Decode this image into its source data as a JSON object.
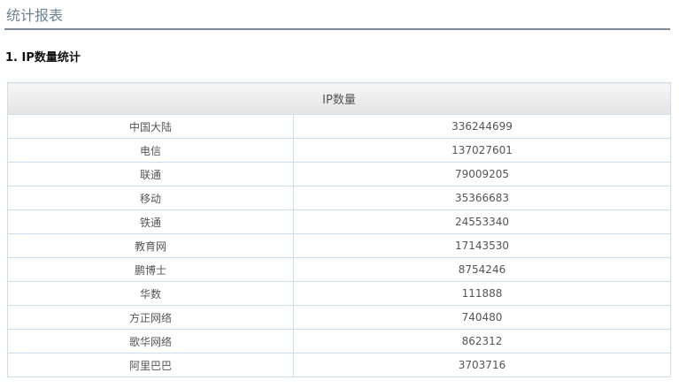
{
  "page_title": "统计报表",
  "section_title": "1. IP数量统计",
  "table": {
    "header": "IP数量",
    "rows": [
      {
        "name": "中国大陆",
        "count": "336244699"
      },
      {
        "name": "电信",
        "count": "137027601"
      },
      {
        "name": "联通",
        "count": "79009205"
      },
      {
        "name": "移动",
        "count": "35366683"
      },
      {
        "name": "铁通",
        "count": "24553340"
      },
      {
        "name": "教育网",
        "count": "17143530"
      },
      {
        "name": "鹏博士",
        "count": "8754246"
      },
      {
        "name": "华数",
        "count": "111888"
      },
      {
        "name": "方正网络",
        "count": "740480"
      },
      {
        "name": "歌华网络",
        "count": "862312"
      },
      {
        "name": "阿里巴巴",
        "count": "3703716"
      }
    ]
  }
}
